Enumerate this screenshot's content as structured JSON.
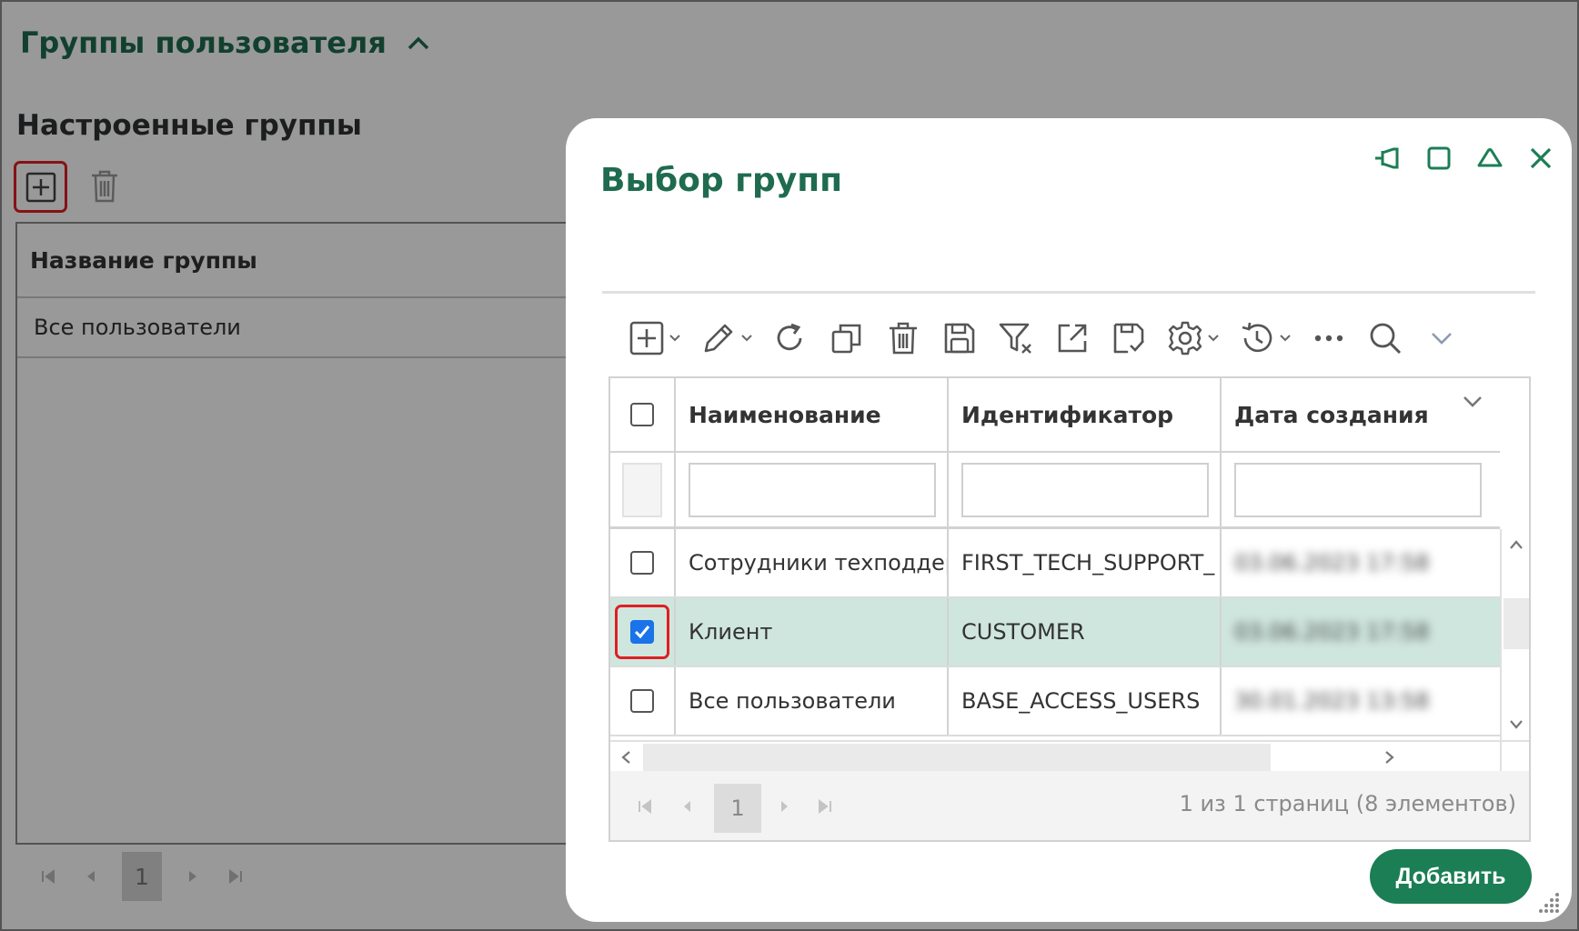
{
  "page": {
    "section_title": "Группы пользователя",
    "subsection_title": "Настроенные группы",
    "table": {
      "column_header": "Название группы",
      "rows": [
        "Все пользователи"
      ]
    },
    "pager": {
      "current_page": "1"
    }
  },
  "dialog": {
    "title": "Выбор групп",
    "window_controls": [
      "pin-icon",
      "maximize-icon",
      "collapse-icon",
      "close-icon"
    ],
    "toolbar": [
      "add-icon",
      "edit-icon",
      "refresh-icon",
      "copy-icon",
      "delete-icon",
      "save-icon",
      "clear-filter-icon",
      "export-icon",
      "import-icon",
      "settings-icon",
      "history-icon",
      "more-icon",
      "search-icon",
      "expand-icon"
    ],
    "grid": {
      "columns": [
        "Наименование",
        "Идентификатор",
        "Дата создания"
      ],
      "rows": [
        {
          "name": "Сотрудники техподдерж",
          "identifier": "FIRST_TECH_SUPPORT_",
          "created": "03.06.2023 17:58",
          "checked": false
        },
        {
          "name": "Клиент",
          "identifier": "CUSTOMER",
          "created": "03.06.2023 17:58",
          "checked": true
        },
        {
          "name": "Все пользователи",
          "identifier": "BASE_ACCESS_USERS",
          "created": "30.01.2023 13:58",
          "checked": false
        }
      ],
      "selected_row_color": "#cfe6de"
    },
    "pager": {
      "current_page": "1",
      "info": "1 из 1 страниц (8 элементов)"
    },
    "add_button_label": "Добавить"
  },
  "colors": {
    "accent_green": "#1f6b4f",
    "button_green": "#1b7e55",
    "highlight_red": "#e01e24",
    "checkbox_blue": "#1a73e8"
  }
}
